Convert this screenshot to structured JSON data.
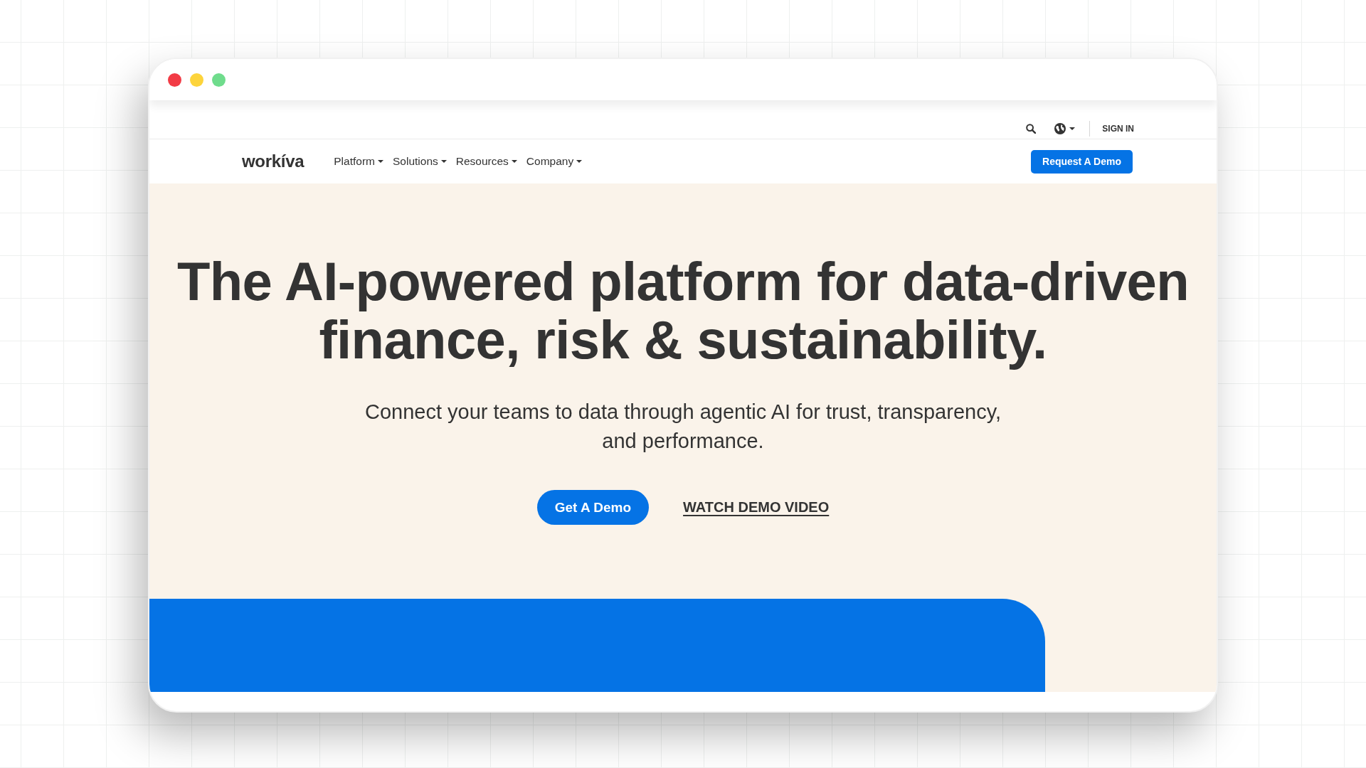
{
  "window": {
    "controls": [
      {
        "color": "#f23b45"
      },
      {
        "color": "#fdd43b"
      },
      {
        "color": "#6fdc8c"
      }
    ]
  },
  "utility_bar": {
    "sign_in": "SIGN IN"
  },
  "nav": {
    "logo": "workíva",
    "items": [
      {
        "label": "Platform",
        "dropdown": true
      },
      {
        "label": "Solutions",
        "dropdown": true
      },
      {
        "label": "Resources",
        "dropdown": true
      },
      {
        "label": "Company",
        "dropdown": true
      }
    ],
    "cta": "Request A Demo"
  },
  "hero": {
    "headline": "The AI-powered platform for data-driven finance, risk & sustainability.",
    "subheadline": "Connect your teams to data through agentic AI for trust, transparency, and performance.",
    "primary_button": "Get A Demo",
    "secondary_link": "WATCH DEMO VIDEO"
  }
}
